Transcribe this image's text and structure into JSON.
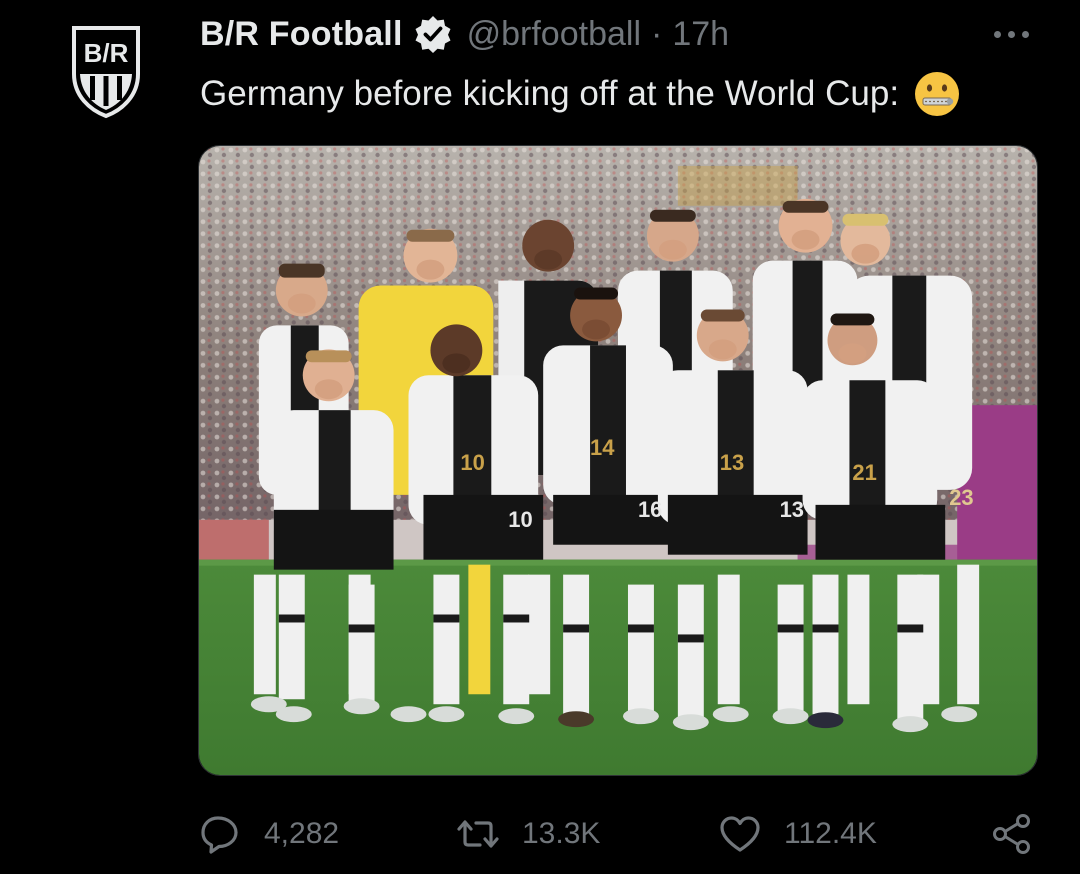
{
  "author": {
    "display_name": "B/R Football",
    "handle": "@brfootball",
    "separator": "·",
    "time": "17h",
    "verified": true,
    "avatar_logo_text": "B/R"
  },
  "tweet": {
    "text": "Germany before kicking off at the World Cup:",
    "emoji": "zipper-mouth-face-emoji"
  },
  "media": {
    "kind": "photo",
    "jersey_numbers": [
      "10",
      "14",
      "13",
      "21",
      "23",
      "16",
      "13",
      "10"
    ]
  },
  "actions": {
    "reply_count": "4,282",
    "retweet_count": "13.3K",
    "like_count": "112.4K"
  },
  "icons": {
    "reply": "speech-bubble-icon",
    "retweet": "retweet-arrows-icon",
    "like": "heart-icon",
    "share": "share-nodes-icon",
    "more": "more-dots-icon",
    "verified": "verified-badge-icon"
  },
  "colors": {
    "background": "#000000",
    "primary_text": "#e7e9ea",
    "secondary_text": "#71767b",
    "verified_badge": "#e7e9ea",
    "pitch_green": "#4f8a3a",
    "gk_yellow": "#f2d53c"
  }
}
